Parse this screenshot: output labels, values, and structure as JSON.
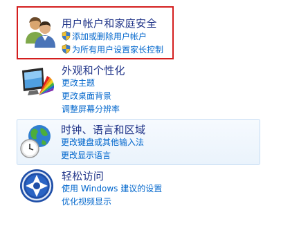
{
  "sections": [
    {
      "id": "users",
      "title": "用户帐户和家庭安全",
      "icon": "users-family-icon",
      "links": [
        {
          "label": "添加或删除用户帐户",
          "icon": "uac-shield-icon"
        },
        {
          "label": "为所有用户设置家长控制",
          "icon": "uac-shield-icon"
        }
      ],
      "highlight_color": "#d41e1e"
    },
    {
      "id": "appearance",
      "title": "外观和个性化",
      "icon": "monitor-palette-icon",
      "links": [
        {
          "label": "更改主题"
        },
        {
          "label": "更改桌面背景"
        },
        {
          "label": "调整屏幕分辨率"
        }
      ]
    },
    {
      "id": "clock",
      "title": "时钟、语言和区域",
      "icon": "globe-clock-icon",
      "links": [
        {
          "label": "更改键盘或其他输入法"
        },
        {
          "label": "更改显示语言"
        }
      ]
    },
    {
      "id": "access",
      "title": "轻松访问",
      "icon": "ease-of-access-icon",
      "links": [
        {
          "label": "使用 Windows 建议的设置"
        },
        {
          "label": "优化视频显示"
        }
      ]
    }
  ],
  "colors": {
    "title": "#1e3287",
    "link": "#0066cc",
    "highlight_border": "#d41e1e",
    "hover_border": "#c5dcf3"
  }
}
